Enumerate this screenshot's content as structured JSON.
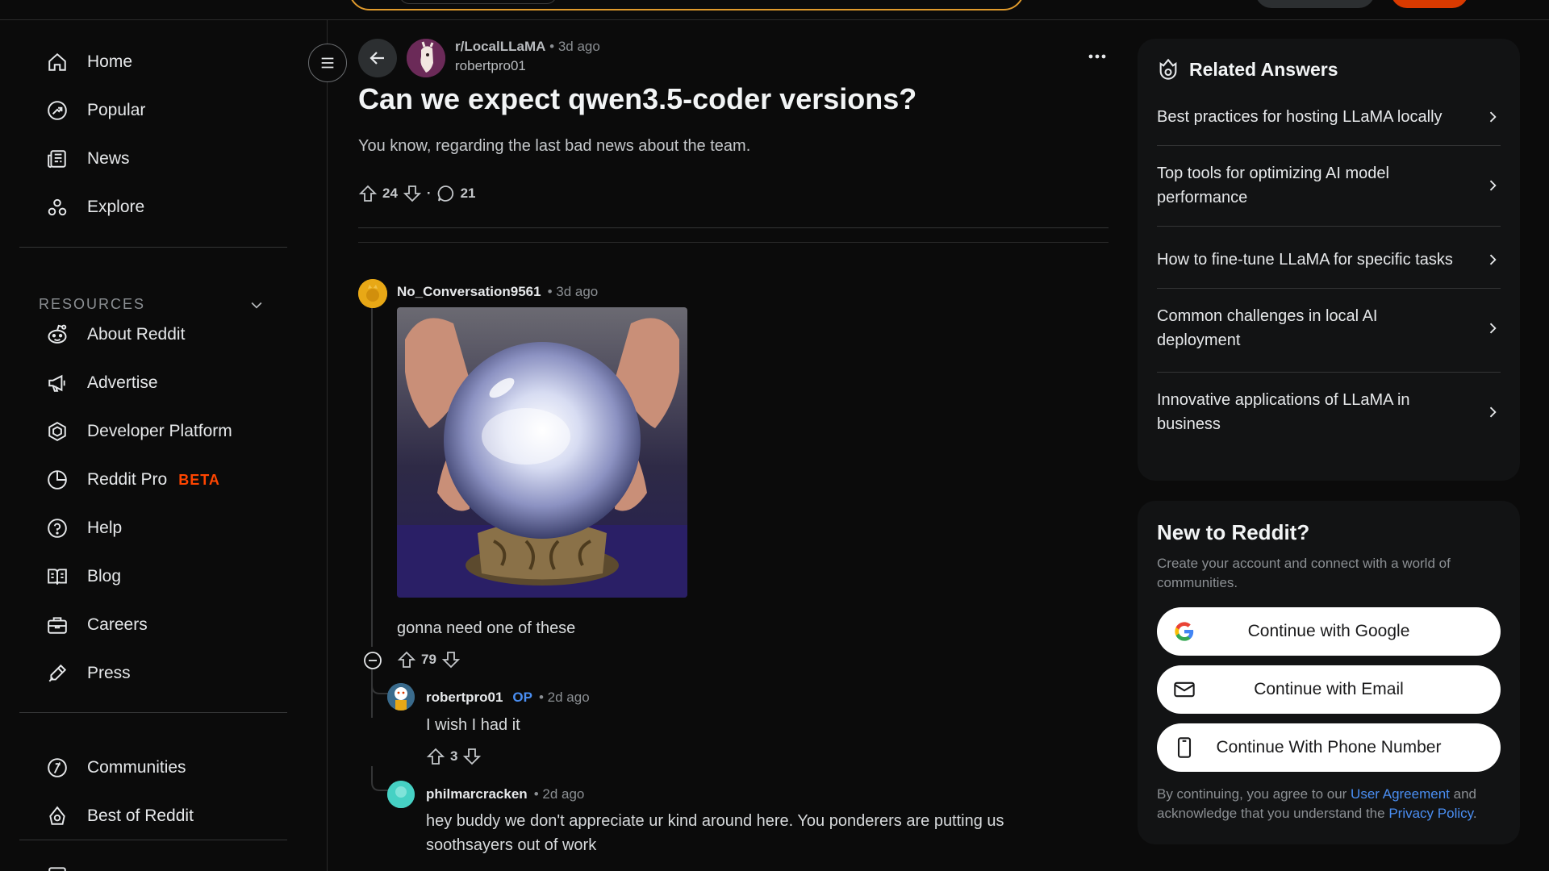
{
  "sidebar": {
    "nav": [
      {
        "label": "Home",
        "icon": "home-icon"
      },
      {
        "label": "Popular",
        "icon": "popular-icon"
      },
      {
        "label": "News",
        "icon": "news-icon"
      },
      {
        "label": "Explore",
        "icon": "explore-icon"
      }
    ],
    "resources_header": "RESOURCES",
    "resources": [
      {
        "label": "About Reddit",
        "icon": "reddit-icon"
      },
      {
        "label": "Advertise",
        "icon": "megaphone-icon"
      },
      {
        "label": "Developer Platform",
        "icon": "developer-icon"
      },
      {
        "label": "Reddit Pro",
        "icon": "pro-icon",
        "badge": "BETA"
      },
      {
        "label": "Help",
        "icon": "help-icon"
      },
      {
        "label": "Blog",
        "icon": "blog-icon"
      },
      {
        "label": "Careers",
        "icon": "briefcase-icon"
      },
      {
        "label": "Press",
        "icon": "press-icon"
      }
    ],
    "more": [
      {
        "label": "Communities",
        "icon": "communities-icon"
      },
      {
        "label": "Best of Reddit",
        "icon": "best-icon"
      }
    ]
  },
  "post": {
    "subreddit": "r/LocalLLaMA",
    "time": "3d ago",
    "author": "robertpro01",
    "title": "Can we expect qwen3.5-coder versions?",
    "body": "You know, regarding the last bad news about the team.",
    "score": "24",
    "comments": "21"
  },
  "comments": [
    {
      "author": "No_Conversation9561",
      "time": "• 3d ago",
      "text": "gonna need one of these",
      "score": "79"
    },
    {
      "author": "robertpro01",
      "badge": "OP",
      "time": "• 2d ago",
      "text": "I wish I had it",
      "score": "3"
    },
    {
      "author": "philmarcracken",
      "time": "• 2d ago",
      "text": "hey buddy we don't appreciate ur kind around here. You ponderers are putting us soothsayers out of work"
    }
  ],
  "related": {
    "title": "Related Answers",
    "items": [
      "Best practices for hosting LLaMA locally",
      "Top tools for optimizing AI model performance",
      "How to fine-tune LLaMA for specific tasks",
      "Common challenges in local AI deployment",
      "Innovative applications of LLaMA in business"
    ]
  },
  "signup": {
    "title": "New to Reddit?",
    "subtitle": "Create your account and connect with a world of communities.",
    "google": "Continue with Google",
    "email": "Continue with Email",
    "phone": "Continue With Phone Number",
    "legal_pre": "By continuing, you agree to our ",
    "legal_link1": "User Agreement",
    "legal_mid": " and acknowledge that you understand the ",
    "legal_link2": "Privacy Policy",
    "legal_post": "."
  },
  "colors": {
    "accent": "#ff4500",
    "link": "#4a8ef2",
    "bg": "#0b0b0b",
    "card": "#121314"
  }
}
